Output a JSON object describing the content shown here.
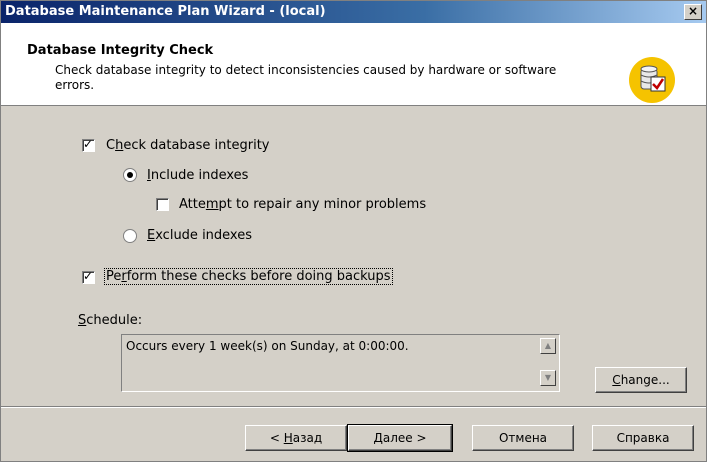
{
  "window": {
    "title": "Database Maintenance Plan Wizard - (local)",
    "close_glyph": "×"
  },
  "header": {
    "title": "Database Integrity Check",
    "description": "Check database integrity to detect inconsistencies caused by hardware or software errors.",
    "icon": "database-check-icon"
  },
  "options": {
    "check_integrity": {
      "label_pre": "C",
      "label_u": "h",
      "label_post": "eck database integrity",
      "checked": true
    },
    "include_indexes": {
      "label_u": "I",
      "label_post": "nclude indexes",
      "selected": true
    },
    "attempt_repair": {
      "label_pre": "Atte",
      "label_u": "m",
      "label_post": "pt to repair any minor problems",
      "checked": false
    },
    "exclude_indexes": {
      "label_u": "E",
      "label_post": "xclude indexes",
      "selected": false
    },
    "perform_before_backup": {
      "label_pre": "Pe",
      "label_u": "r",
      "label_post": "form these checks before doing backups",
      "checked": true
    }
  },
  "schedule": {
    "label_u": "S",
    "label_post": "chedule:",
    "text": "Occurs every 1 week(s) on Sunday, at 0:00:00.",
    "change_u": "C",
    "change_post": "hange..."
  },
  "footer": {
    "back_pre": "< ",
    "back_u": "Н",
    "back_post": "азад",
    "next_u": "Д",
    "next_post": "алее >",
    "cancel": "Отмена",
    "help": "Справка"
  }
}
